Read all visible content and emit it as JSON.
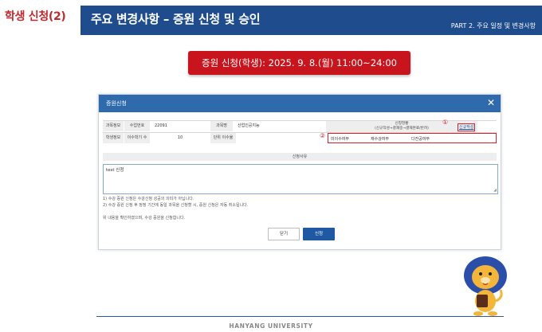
{
  "slide": {
    "side_title": "학생 신청(2)",
    "header_title": "주요 변경사항 – 증원 신청 및 승인",
    "header_part": "PART 2. 주요 일정 및 변경사항",
    "date_banner": "증원 신청(학생): 2025. 9. 8.(월) 11:00~24:00",
    "footer": "HANYANG UNIVERSITY"
  },
  "dialog": {
    "title": "증원신청",
    "close_icon": "close-icon",
    "course_info": {
      "section_label": "과목정보",
      "course_no_label": "수업번호",
      "course_no": "22091",
      "course_name_label": "과목명",
      "course_name": "산업인공지능"
    },
    "status_header_line1": "신청현황",
    "status_header_line2": "(신규작성→결재중→결재완료/반려)",
    "marker_1": "①",
    "new_app_link": "신규작성",
    "student_info": {
      "section_label": "학생정보",
      "semesters_label": "이수학기 수",
      "semesters": "10",
      "units_label": "단위 이수율",
      "units": ""
    },
    "marker_2": "②",
    "status_items": [
      "미이수여부",
      "재수강여부",
      "다전공여부"
    ],
    "reason_label": "신청사유",
    "reason_text": "test 신청",
    "notes": [
      "1) 수강 증원 신청은 수강신청 성공의 의미가 아닙니다.",
      "2) 수강 증원 신청 후 정정 기간에 동일 과목을 신청할 시, 증원 신청은 자동 취소됩니다."
    ],
    "confirm_text": "위 내용을 확인하였으며, 수강 증원을 신청합니다.",
    "close_button": "닫기",
    "apply_button": "신청"
  },
  "colors": {
    "header_blue": "#1e4c8c",
    "banner_red": "#c8151d",
    "dialog_blue": "#2f6aac",
    "highlight_red": "#d0202a",
    "apply_blue": "#1f58a3"
  }
}
